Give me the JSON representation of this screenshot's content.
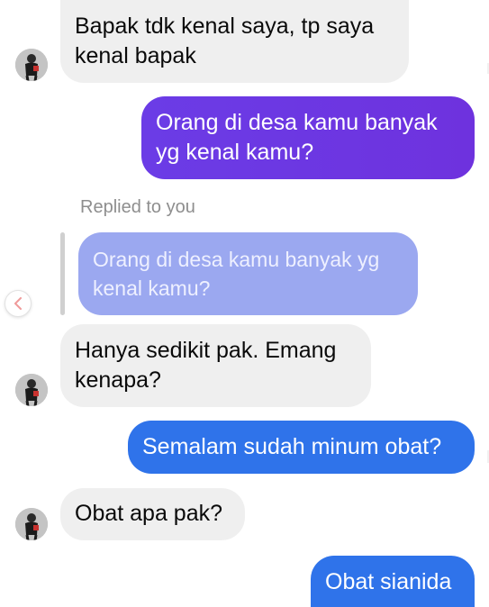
{
  "messages": {
    "m1": {
      "lines": [
        "Bapak tdk kenal saya, tp saya",
        "kenal bapak"
      ]
    },
    "m2": {
      "lines": [
        "Orang di desa kamu banyak",
        "yg kenal kamu?"
      ]
    },
    "reply_label": "Replied to you",
    "quoted": {
      "lines": [
        "Orang di desa kamu banyak yg",
        "kenal kamu?"
      ]
    },
    "m3": {
      "lines": [
        "Hanya sedikit pak. Emang",
        "kenapa?"
      ]
    },
    "m4": {
      "text": "Semalam sudah minum obat?"
    },
    "m5": {
      "text": "Obat apa pak?"
    },
    "m6": {
      "text": "Obat sianida"
    }
  },
  "colors": {
    "incoming_bubble": "#efefef",
    "outgoing_purple": "#6b3ce6",
    "outgoing_blue": "#2f73ea",
    "quoted_bubble": "#9ba8f0"
  },
  "icons": {
    "avatar": "contact-avatar",
    "back": "chevron-left-icon"
  }
}
